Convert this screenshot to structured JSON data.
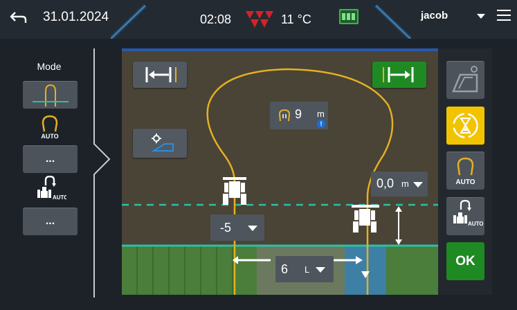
{
  "header": {
    "date": "31.01.2024",
    "time": "02:08",
    "temperature": "11 °C",
    "user": "jacob"
  },
  "left_panel": {
    "mode_label": "Mode",
    "auto_label_1": "AUTO",
    "more_button_1": "...",
    "auto_label_2": "AUTO",
    "more_button_2": "..."
  },
  "field": {
    "turn_radius_value": "9",
    "turn_radius_unit": "m",
    "offset_value": "0,0",
    "offset_unit": "m",
    "headland_value": "-5",
    "skip_value": "6",
    "skip_unit": "L"
  },
  "right_panel": {
    "auto_label_1": "AUTO",
    "auto_label_2": "AUTO",
    "ok_label": "OK"
  },
  "colors": {
    "accent_blue": "#2a58a8",
    "turn_path": "#e5b021",
    "guidance_line": "#e5d41a",
    "headland_line": "#2bc0a8",
    "active_green": "#1f8a23",
    "highlight_yellow": "#f2c400"
  },
  "icons": {
    "back": "back-arrow-icon",
    "brand": "triple-triangle-logo-icon",
    "signal": "gnss-signal-icon",
    "menu": "hamburger-menu-icon"
  }
}
